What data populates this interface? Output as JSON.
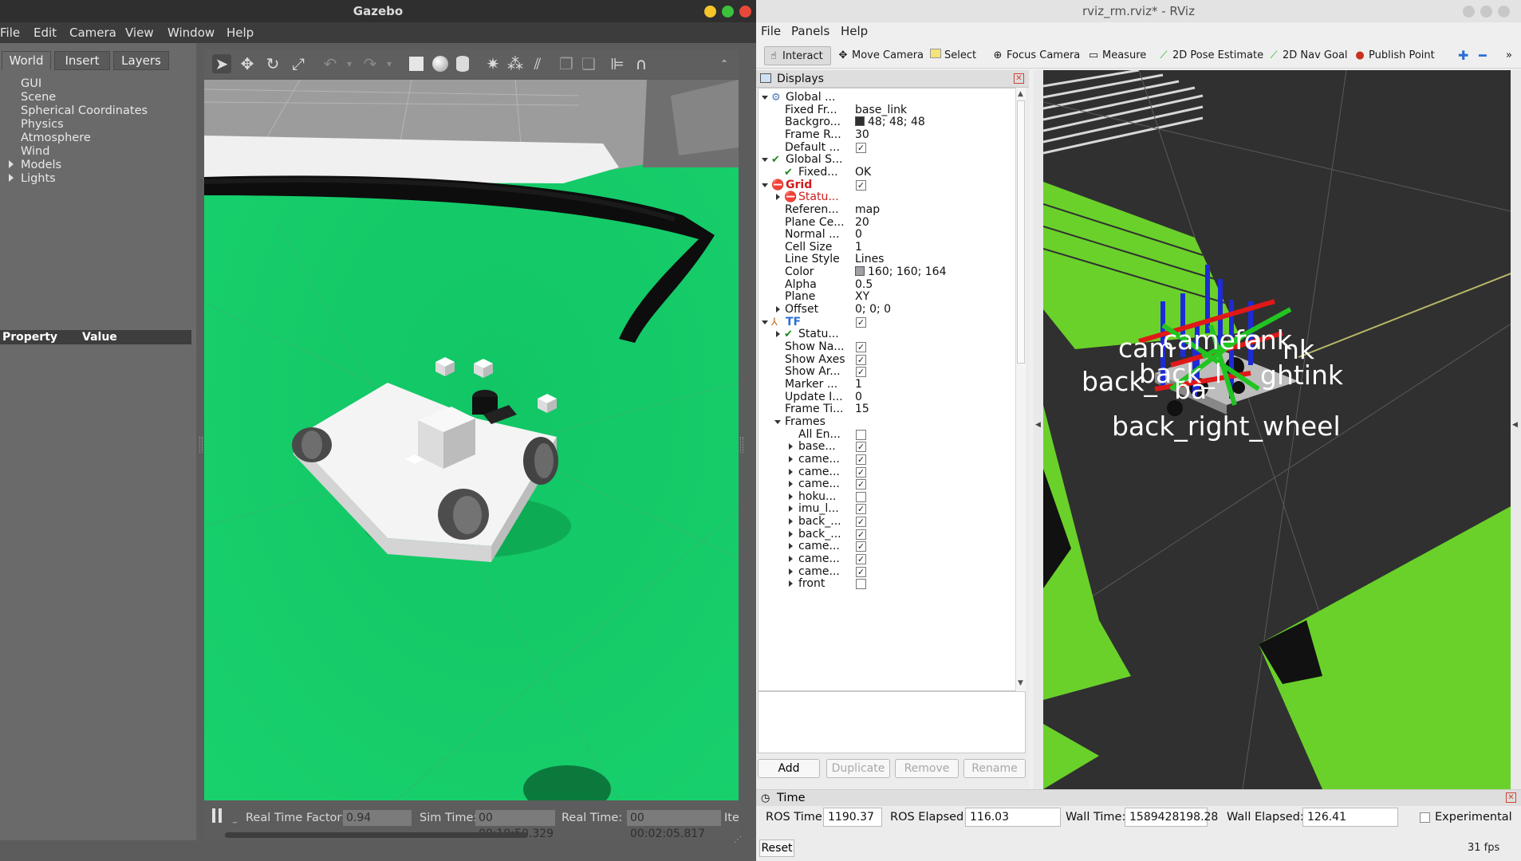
{
  "gazebo": {
    "title": "Gazebo",
    "menu": [
      "File",
      "Edit",
      "Camera",
      "View",
      "Window",
      "Help"
    ],
    "tabs": [
      "World",
      "Insert",
      "Layers"
    ],
    "world_tree": [
      {
        "label": "GUI",
        "expandable": false
      },
      {
        "label": "Scene",
        "expandable": false
      },
      {
        "label": "Spherical Coordinates",
        "expandable": false
      },
      {
        "label": "Physics",
        "expandable": false
      },
      {
        "label": "Atmosphere",
        "expandable": false
      },
      {
        "label": "Wind",
        "expandable": false
      },
      {
        "label": "Models",
        "expandable": true
      },
      {
        "label": "Lights",
        "expandable": true
      }
    ],
    "property_header": "Property",
    "value_header": "Value",
    "toolbar_icons": [
      "select-arrow-icon",
      "translate-icon",
      "rotate-icon",
      "scale-icon",
      "undo-icon",
      "undo-dropdown-icon",
      "redo-icon",
      "redo-dropdown-icon",
      "box-icon",
      "sphere-icon",
      "cylinder-icon",
      "point-light-icon",
      "spot-light-icon",
      "directional-light-icon",
      "copy-icon",
      "paste-icon",
      "align-icon",
      "magnet-icon",
      "toolbar-expand-icon"
    ],
    "status": {
      "real_time_factor_label": "Real Time Factor:",
      "real_time_factor": "0.94",
      "sim_time_label": "Sim Time:",
      "sim_time": "00 00:19:50.329",
      "real_time_label": "Real Time:",
      "real_time": "00 00:02:05.817",
      "iterations_label": "Ite"
    },
    "ground_color": "#19c76a"
  },
  "rviz": {
    "title": "rviz_rm.rviz* - RViz",
    "menu": [
      "File",
      "Panels",
      "Help"
    ],
    "tools": [
      {
        "label": "Interact",
        "icon": "interact-icon"
      },
      {
        "label": "Move Camera",
        "icon": "move-camera-icon"
      },
      {
        "label": "Select",
        "icon": "select-icon"
      },
      {
        "label": "Focus Camera",
        "icon": "focus-camera-icon"
      },
      {
        "label": "Measure",
        "icon": "measure-icon"
      },
      {
        "label": "2D Pose Estimate",
        "icon": "pose-estimate-icon"
      },
      {
        "label": "2D Nav Goal",
        "icon": "nav-goal-icon"
      },
      {
        "label": "Publish Point",
        "icon": "publish-point-icon"
      }
    ],
    "displays_title": "Displays",
    "rows": [
      {
        "indent": 0,
        "arrow": "down",
        "icon": "gear",
        "name": "Global ...",
        "value": ""
      },
      {
        "indent": 1,
        "name": "Fixed Fr...",
        "value": "base_link"
      },
      {
        "indent": 1,
        "name": "Backgro...",
        "value": "48; 48; 48",
        "swatch": "#303030"
      },
      {
        "indent": 1,
        "name": "Frame R...",
        "value": "30"
      },
      {
        "indent": 1,
        "name": "Default ...",
        "check": true
      },
      {
        "indent": 0,
        "arrow": "down",
        "icon": "ok",
        "name": "Global S...",
        "value": ""
      },
      {
        "indent": 1,
        "icon": "ok",
        "name": "Fixed...",
        "value": "OK"
      },
      {
        "indent": 0,
        "arrow": "down",
        "icon": "err",
        "name": "Grid",
        "check": true,
        "style": "red"
      },
      {
        "indent": 1,
        "arrow": "right",
        "icon": "err",
        "name": "Statu...",
        "style": "red"
      },
      {
        "indent": 1,
        "name": "Referen...",
        "value": "map"
      },
      {
        "indent": 1,
        "name": "Plane Ce...",
        "value": "20"
      },
      {
        "indent": 1,
        "name": "Normal ...",
        "value": "0"
      },
      {
        "indent": 1,
        "name": "Cell Size",
        "value": "1"
      },
      {
        "indent": 1,
        "name": "Line Style",
        "value": "Lines"
      },
      {
        "indent": 1,
        "name": "Color",
        "value": "160; 160; 164",
        "swatch": "#a0a0a4"
      },
      {
        "indent": 1,
        "name": "Alpha",
        "value": "0.5"
      },
      {
        "indent": 1,
        "name": "Plane",
        "value": "XY"
      },
      {
        "indent": 1,
        "arrow": "right",
        "name": "Offset",
        "value": "0; 0; 0"
      },
      {
        "indent": 0,
        "arrow": "down",
        "icon": "tf",
        "name": "TF",
        "check": true,
        "style": "blue"
      },
      {
        "indent": 1,
        "arrow": "right",
        "icon": "ok",
        "name": "Statu..."
      },
      {
        "indent": 1,
        "name": "Show Na...",
        "check": true
      },
      {
        "indent": 1,
        "name": "Show Axes",
        "check": true
      },
      {
        "indent": 1,
        "name": "Show Ar...",
        "check": true
      },
      {
        "indent": 1,
        "name": "Marker ...",
        "value": "1"
      },
      {
        "indent": 1,
        "name": "Update I...",
        "value": "0"
      },
      {
        "indent": 1,
        "name": "Frame Ti...",
        "value": "15"
      },
      {
        "indent": 1,
        "arrow": "down",
        "name": "Frames"
      },
      {
        "indent": 2,
        "name": "All En...",
        "check": false
      },
      {
        "indent": 2,
        "arrow": "right",
        "name": "base...",
        "check": true
      },
      {
        "indent": 2,
        "arrow": "right",
        "name": "came...",
        "check": true
      },
      {
        "indent": 2,
        "arrow": "right",
        "name": "came...",
        "check": true
      },
      {
        "indent": 2,
        "arrow": "right",
        "name": "came...",
        "check": true
      },
      {
        "indent": 2,
        "arrow": "right",
        "name": "hoku...",
        "check": false
      },
      {
        "indent": 2,
        "arrow": "right",
        "name": "imu_l...",
        "check": true
      },
      {
        "indent": 2,
        "arrow": "right",
        "name": "back_...",
        "check": true
      },
      {
        "indent": 2,
        "arrow": "right",
        "name": "back_...",
        "check": true
      },
      {
        "indent": 2,
        "arrow": "right",
        "name": "came...",
        "check": true
      },
      {
        "indent": 2,
        "arrow": "right",
        "name": "came...",
        "check": true
      },
      {
        "indent": 2,
        "arrow": "right",
        "name": "came...",
        "check": true
      },
      {
        "indent": 2,
        "arrow": "right",
        "name": "front",
        "check": false
      }
    ],
    "buttons": [
      "Add",
      "Duplicate",
      "Remove",
      "Rename"
    ],
    "tf_labels": [
      "cam",
      "camera",
      "fonk",
      "back_l",
      "back_",
      "ba",
      "nk",
      "ghtink",
      "back_right_wheel"
    ],
    "time_panel": {
      "title": "Time",
      "ros_time_label": "ROS Time:",
      "ros_time": "1190.37",
      "ros_elapsed_label": "ROS Elapsed:",
      "ros_elapsed": "116.03",
      "wall_time_label": "Wall Time:",
      "wall_time": "1589428198.28",
      "wall_elapsed_label": "Wall Elapsed:",
      "wall_elapsed": "126.41",
      "experimental_label": "Experimental",
      "reset_label": "Reset",
      "fps": "31 fps"
    },
    "floor_color": "#6ad12a",
    "background_color": "#303030"
  }
}
